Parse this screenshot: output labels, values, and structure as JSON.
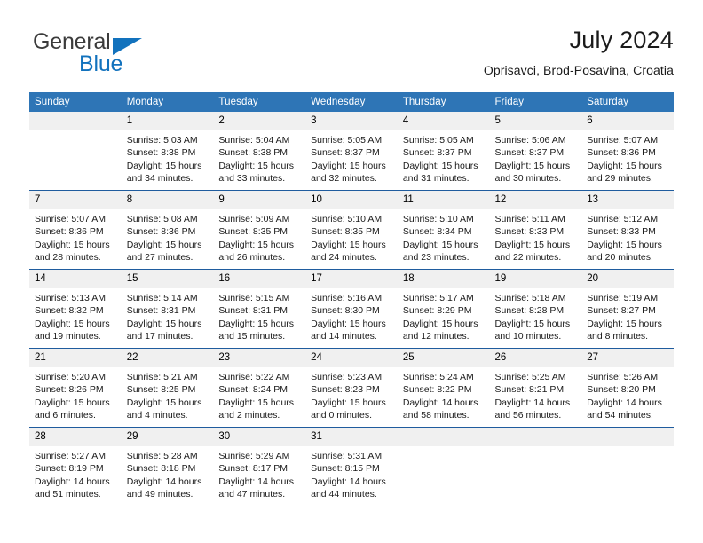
{
  "brand": {
    "line1": "General",
    "line2": "Blue",
    "triangle_icon": "triangle-icon",
    "color_dark": "#3b3b3b",
    "color_blue": "#1272bd"
  },
  "header": {
    "title": "July 2024",
    "location": "Oprisavci, Brod-Posavina, Croatia"
  },
  "theme": {
    "header_blue": "#2e75b6",
    "row_divider_blue": "#1f5c9e",
    "daynum_band": "#f0f0f0"
  },
  "weekday_headers": [
    "Sunday",
    "Monday",
    "Tuesday",
    "Wednesday",
    "Thursday",
    "Friday",
    "Saturday"
  ],
  "weeks": [
    [
      {
        "day": "",
        "sunrise": "",
        "sunset": "",
        "daylight1": "",
        "daylight2": ""
      },
      {
        "day": "1",
        "sunrise": "Sunrise: 5:03 AM",
        "sunset": "Sunset: 8:38 PM",
        "daylight1": "Daylight: 15 hours",
        "daylight2": "and 34 minutes."
      },
      {
        "day": "2",
        "sunrise": "Sunrise: 5:04 AM",
        "sunset": "Sunset: 8:38 PM",
        "daylight1": "Daylight: 15 hours",
        "daylight2": "and 33 minutes."
      },
      {
        "day": "3",
        "sunrise": "Sunrise: 5:05 AM",
        "sunset": "Sunset: 8:37 PM",
        "daylight1": "Daylight: 15 hours",
        "daylight2": "and 32 minutes."
      },
      {
        "day": "4",
        "sunrise": "Sunrise: 5:05 AM",
        "sunset": "Sunset: 8:37 PM",
        "daylight1": "Daylight: 15 hours",
        "daylight2": "and 31 minutes."
      },
      {
        "day": "5",
        "sunrise": "Sunrise: 5:06 AM",
        "sunset": "Sunset: 8:37 PM",
        "daylight1": "Daylight: 15 hours",
        "daylight2": "and 30 minutes."
      },
      {
        "day": "6",
        "sunrise": "Sunrise: 5:07 AM",
        "sunset": "Sunset: 8:36 PM",
        "daylight1": "Daylight: 15 hours",
        "daylight2": "and 29 minutes."
      }
    ],
    [
      {
        "day": "7",
        "sunrise": "Sunrise: 5:07 AM",
        "sunset": "Sunset: 8:36 PM",
        "daylight1": "Daylight: 15 hours",
        "daylight2": "and 28 minutes."
      },
      {
        "day": "8",
        "sunrise": "Sunrise: 5:08 AM",
        "sunset": "Sunset: 8:36 PM",
        "daylight1": "Daylight: 15 hours",
        "daylight2": "and 27 minutes."
      },
      {
        "day": "9",
        "sunrise": "Sunrise: 5:09 AM",
        "sunset": "Sunset: 8:35 PM",
        "daylight1": "Daylight: 15 hours",
        "daylight2": "and 26 minutes."
      },
      {
        "day": "10",
        "sunrise": "Sunrise: 5:10 AM",
        "sunset": "Sunset: 8:35 PM",
        "daylight1": "Daylight: 15 hours",
        "daylight2": "and 24 minutes."
      },
      {
        "day": "11",
        "sunrise": "Sunrise: 5:10 AM",
        "sunset": "Sunset: 8:34 PM",
        "daylight1": "Daylight: 15 hours",
        "daylight2": "and 23 minutes."
      },
      {
        "day": "12",
        "sunrise": "Sunrise: 5:11 AM",
        "sunset": "Sunset: 8:33 PM",
        "daylight1": "Daylight: 15 hours",
        "daylight2": "and 22 minutes."
      },
      {
        "day": "13",
        "sunrise": "Sunrise: 5:12 AM",
        "sunset": "Sunset: 8:33 PM",
        "daylight1": "Daylight: 15 hours",
        "daylight2": "and 20 minutes."
      }
    ],
    [
      {
        "day": "14",
        "sunrise": "Sunrise: 5:13 AM",
        "sunset": "Sunset: 8:32 PM",
        "daylight1": "Daylight: 15 hours",
        "daylight2": "and 19 minutes."
      },
      {
        "day": "15",
        "sunrise": "Sunrise: 5:14 AM",
        "sunset": "Sunset: 8:31 PM",
        "daylight1": "Daylight: 15 hours",
        "daylight2": "and 17 minutes."
      },
      {
        "day": "16",
        "sunrise": "Sunrise: 5:15 AM",
        "sunset": "Sunset: 8:31 PM",
        "daylight1": "Daylight: 15 hours",
        "daylight2": "and 15 minutes."
      },
      {
        "day": "17",
        "sunrise": "Sunrise: 5:16 AM",
        "sunset": "Sunset: 8:30 PM",
        "daylight1": "Daylight: 15 hours",
        "daylight2": "and 14 minutes."
      },
      {
        "day": "18",
        "sunrise": "Sunrise: 5:17 AM",
        "sunset": "Sunset: 8:29 PM",
        "daylight1": "Daylight: 15 hours",
        "daylight2": "and 12 minutes."
      },
      {
        "day": "19",
        "sunrise": "Sunrise: 5:18 AM",
        "sunset": "Sunset: 8:28 PM",
        "daylight1": "Daylight: 15 hours",
        "daylight2": "and 10 minutes."
      },
      {
        "day": "20",
        "sunrise": "Sunrise: 5:19 AM",
        "sunset": "Sunset: 8:27 PM",
        "daylight1": "Daylight: 15 hours",
        "daylight2": "and 8 minutes."
      }
    ],
    [
      {
        "day": "21",
        "sunrise": "Sunrise: 5:20 AM",
        "sunset": "Sunset: 8:26 PM",
        "daylight1": "Daylight: 15 hours",
        "daylight2": "and 6 minutes."
      },
      {
        "day": "22",
        "sunrise": "Sunrise: 5:21 AM",
        "sunset": "Sunset: 8:25 PM",
        "daylight1": "Daylight: 15 hours",
        "daylight2": "and 4 minutes."
      },
      {
        "day": "23",
        "sunrise": "Sunrise: 5:22 AM",
        "sunset": "Sunset: 8:24 PM",
        "daylight1": "Daylight: 15 hours",
        "daylight2": "and 2 minutes."
      },
      {
        "day": "24",
        "sunrise": "Sunrise: 5:23 AM",
        "sunset": "Sunset: 8:23 PM",
        "daylight1": "Daylight: 15 hours",
        "daylight2": "and 0 minutes."
      },
      {
        "day": "25",
        "sunrise": "Sunrise: 5:24 AM",
        "sunset": "Sunset: 8:22 PM",
        "daylight1": "Daylight: 14 hours",
        "daylight2": "and 58 minutes."
      },
      {
        "day": "26",
        "sunrise": "Sunrise: 5:25 AM",
        "sunset": "Sunset: 8:21 PM",
        "daylight1": "Daylight: 14 hours",
        "daylight2": "and 56 minutes."
      },
      {
        "day": "27",
        "sunrise": "Sunrise: 5:26 AM",
        "sunset": "Sunset: 8:20 PM",
        "daylight1": "Daylight: 14 hours",
        "daylight2": "and 54 minutes."
      }
    ],
    [
      {
        "day": "28",
        "sunrise": "Sunrise: 5:27 AM",
        "sunset": "Sunset: 8:19 PM",
        "daylight1": "Daylight: 14 hours",
        "daylight2": "and 51 minutes."
      },
      {
        "day": "29",
        "sunrise": "Sunrise: 5:28 AM",
        "sunset": "Sunset: 8:18 PM",
        "daylight1": "Daylight: 14 hours",
        "daylight2": "and 49 minutes."
      },
      {
        "day": "30",
        "sunrise": "Sunrise: 5:29 AM",
        "sunset": "Sunset: 8:17 PM",
        "daylight1": "Daylight: 14 hours",
        "daylight2": "and 47 minutes."
      },
      {
        "day": "31",
        "sunrise": "Sunrise: 5:31 AM",
        "sunset": "Sunset: 8:15 PM",
        "daylight1": "Daylight: 14 hours",
        "daylight2": "and 44 minutes."
      },
      {
        "day": "",
        "sunrise": "",
        "sunset": "",
        "daylight1": "",
        "daylight2": ""
      },
      {
        "day": "",
        "sunrise": "",
        "sunset": "",
        "daylight1": "",
        "daylight2": ""
      },
      {
        "day": "",
        "sunrise": "",
        "sunset": "",
        "daylight1": "",
        "daylight2": ""
      }
    ]
  ]
}
